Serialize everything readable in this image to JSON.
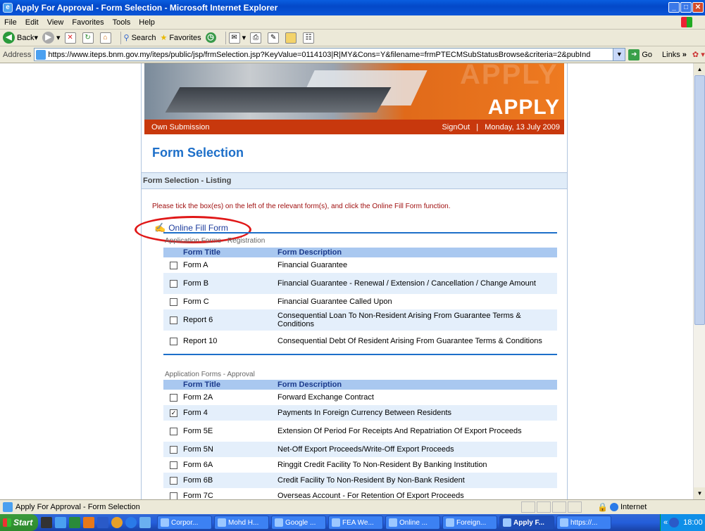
{
  "window": {
    "title": "Apply For Approval - Form Selection - Microsoft Internet Explorer"
  },
  "menu": [
    "File",
    "Edit",
    "View",
    "Favorites",
    "Tools",
    "Help"
  ],
  "toolbar": {
    "back": "Back",
    "search": "Search",
    "favorites": "Favorites"
  },
  "address": {
    "label": "Address",
    "url": "https://www.iteps.bnm.gov.my/iteps/public/jsp/frmSelection.jsp?KeyValue=0114103|R|MY&Cons=Y&filename=frmPTECMSubStatusBrowse&criteria=2&pubInd",
    "go": "Go",
    "links": "Links"
  },
  "banner": {
    "ghost": "APPLY",
    "word": "APPLY"
  },
  "header": {
    "own_submission": "Own Submission",
    "signout": "SignOut",
    "separator": "|",
    "date": "Monday, 13 July 2009"
  },
  "page_title": "Form Selection",
  "listing_title": "Form Selection - Listing",
  "instruction": "Please tick the box(es) on the left of the relevant form(s), and click the Online Fill Form function.",
  "online_fill_form": "Online Fill Form",
  "columns": {
    "title": "Form Title",
    "description": "Form Description"
  },
  "registration": {
    "heading": "Application Forms - Registration",
    "rows": [
      {
        "title": "Form A",
        "desc": "Financial Guarantee",
        "checked": false
      },
      {
        "title": "Form B",
        "desc": "Financial Guarantee - Renewal / Extension / Cancellation / Change Amount",
        "checked": false
      },
      {
        "title": "Form C",
        "desc": "Financial Guarantee Called Upon",
        "checked": false
      },
      {
        "title": "Report 6",
        "desc": "Consequential Loan To Non-Resident Arising From Guarantee Terms & Conditions",
        "checked": false
      },
      {
        "title": "Report 10",
        "desc": "Consequential Debt Of Resident Arising From Guarantee Terms & Conditions",
        "checked": false
      }
    ]
  },
  "approval": {
    "heading": "Application Forms - Approval",
    "rows": [
      {
        "title": "Form 2A",
        "desc": "Forward Exchange Contract",
        "checked": false
      },
      {
        "title": "Form 4",
        "desc": "Payments In Foreign Currency Between Residents",
        "checked": true
      },
      {
        "title": "Form 5E",
        "desc": "Extension Of Period For Receipts And Repatriation Of Export Proceeds",
        "checked": false
      },
      {
        "title": "Form 5N",
        "desc": "Net-Off Export Proceeds/Write-Off Export Proceeds",
        "checked": false
      },
      {
        "title": "Form 6A",
        "desc": "Ringgit Credit Facility To Non-Resident By Banking Institution",
        "checked": false
      },
      {
        "title": "Form 6B",
        "desc": "Credit Facility To Non-Resident By Non-Bank Resident",
        "checked": false
      },
      {
        "title": "Form 7C",
        "desc": "Overseas Account - For Retention Of Export Proceeds",
        "checked": false
      }
    ]
  },
  "status": {
    "text": "Apply For Approval - Form Selection",
    "zone": "Internet"
  },
  "taskbar": {
    "start": "Start",
    "tasks": [
      "Corpor...",
      "Mohd H...",
      "Google ...",
      "FEA We...",
      "Online ...",
      "Foreign...",
      "Apply F...",
      "https://..."
    ],
    "active_index": 6,
    "clock": "18:00"
  },
  "colors": {
    "accent": "#1d6fc9",
    "header_bar": "#c8380d",
    "annotation": "#e01818"
  }
}
